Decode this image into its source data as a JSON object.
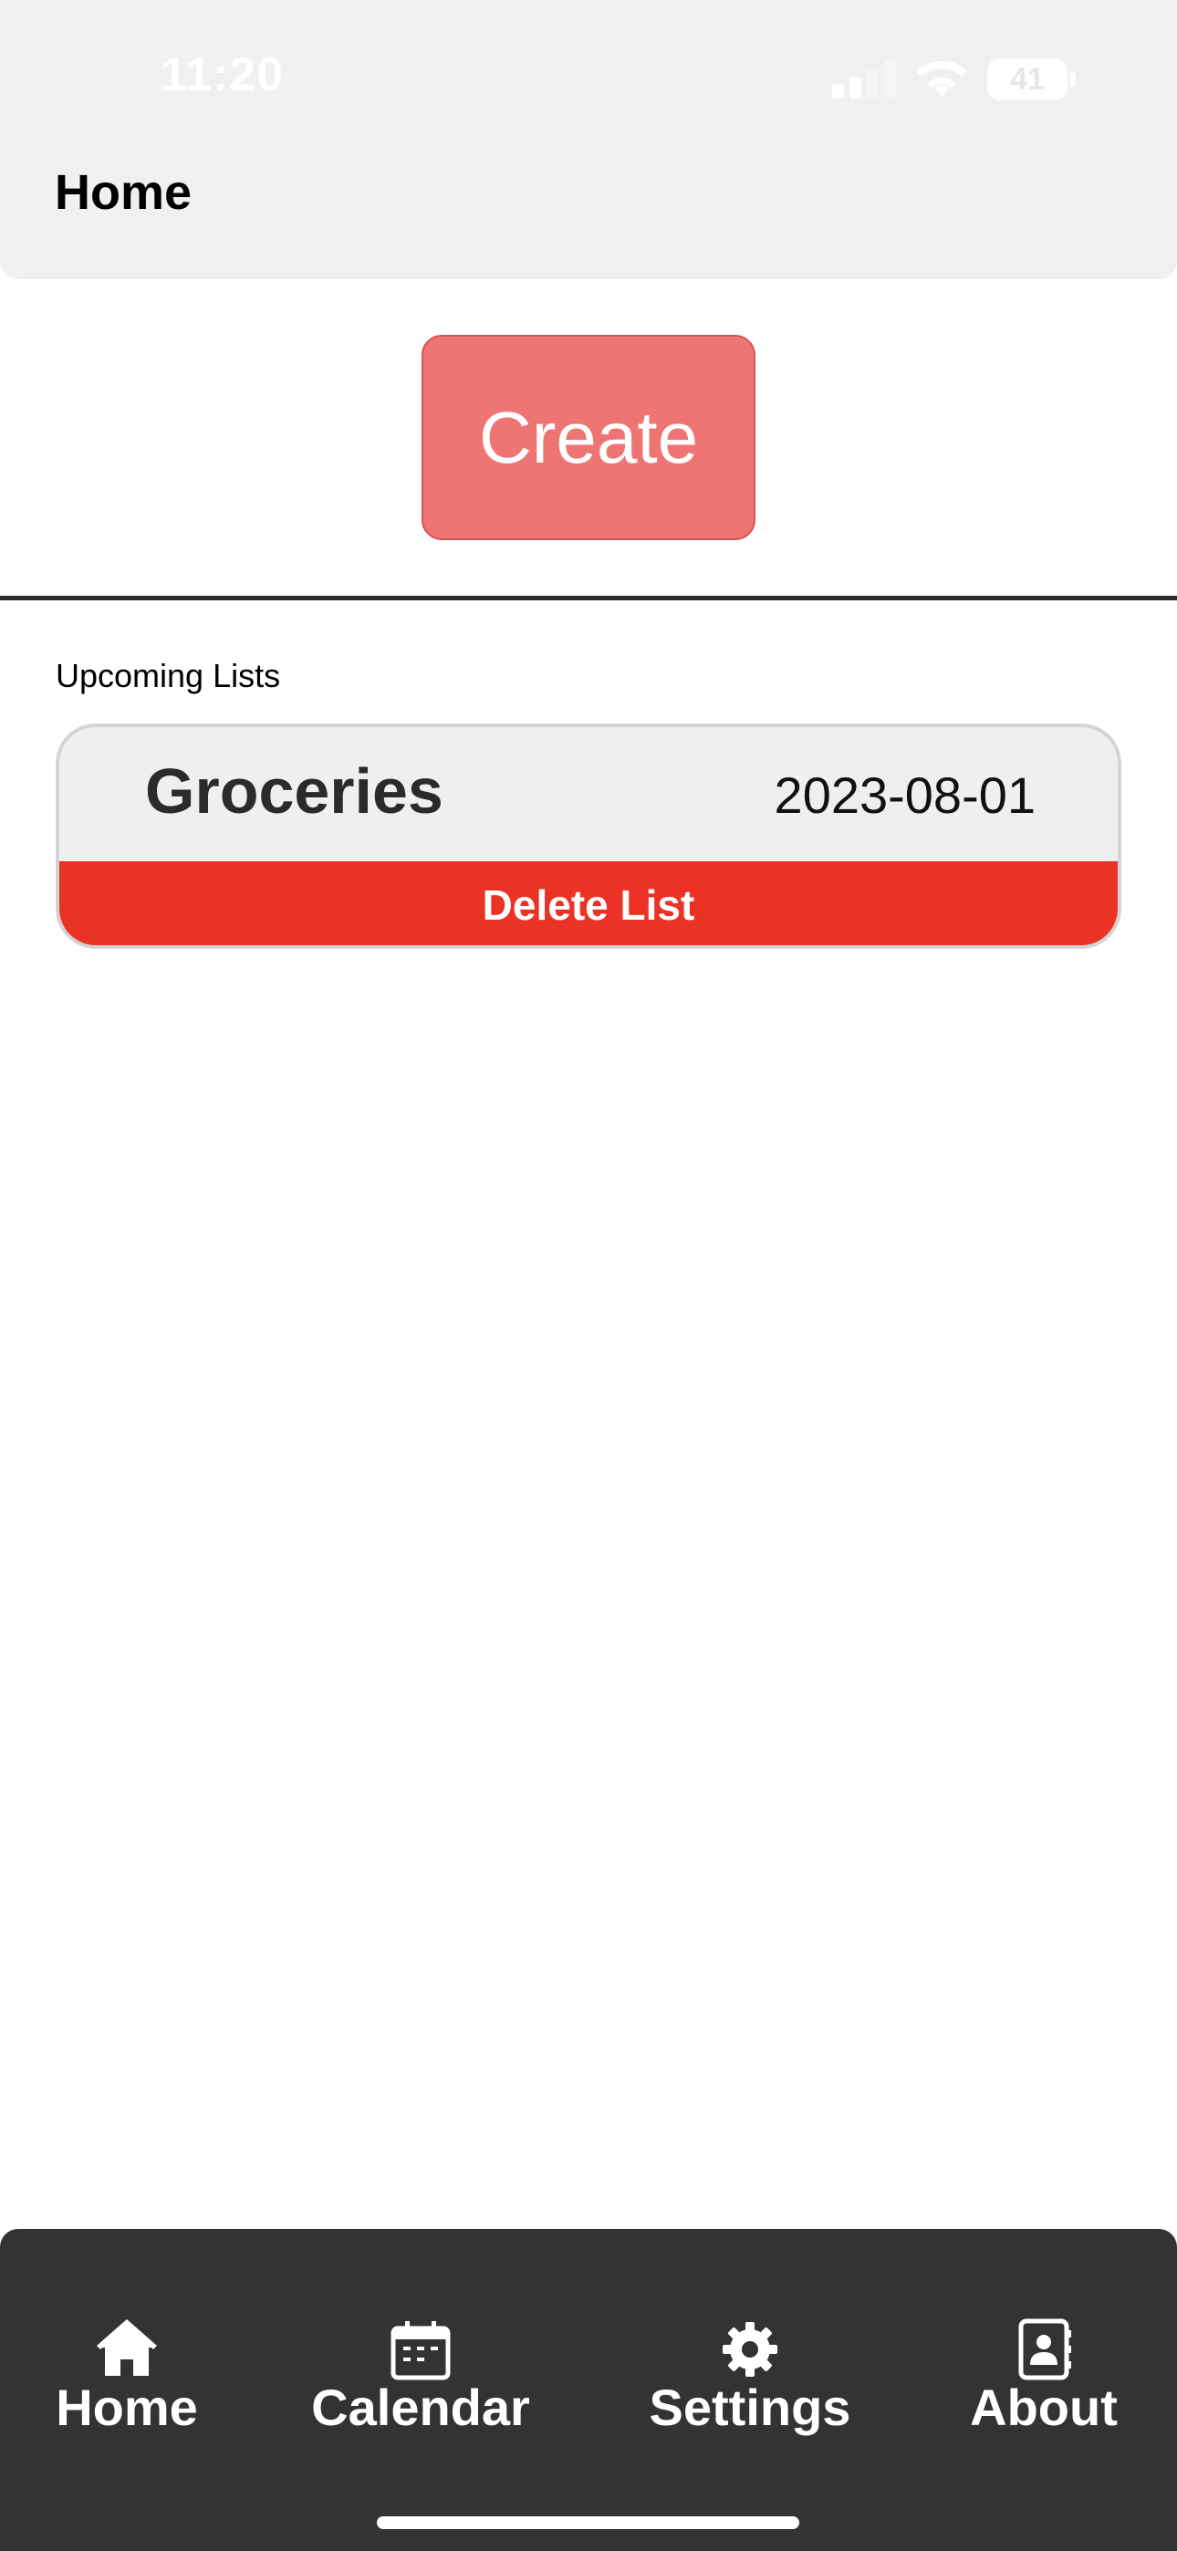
{
  "status_bar": {
    "time": "11:20",
    "battery": "41",
    "icons": [
      "signal-icon",
      "wifi-icon",
      "battery-icon"
    ]
  },
  "header": {
    "title": "Home"
  },
  "main": {
    "create_label": "Create",
    "section_label": "Upcoming Lists",
    "lists": [
      {
        "name": "Groceries",
        "date": "2023-08-01",
        "delete_label": "Delete List"
      }
    ]
  },
  "tab_bar": {
    "items": [
      {
        "label": "Home",
        "icon": "home-icon"
      },
      {
        "label": "Calendar",
        "icon": "calendar-icon"
      },
      {
        "label": "Settings",
        "icon": "gear-icon"
      },
      {
        "label": "About",
        "icon": "contact-book-icon"
      }
    ]
  },
  "colors": {
    "header_bg": "#f0f0f0",
    "create_button": "#ef7574",
    "delete_button": "#ea3324",
    "tab_bar_bg": "#333333",
    "card_bg": "#efefef"
  }
}
